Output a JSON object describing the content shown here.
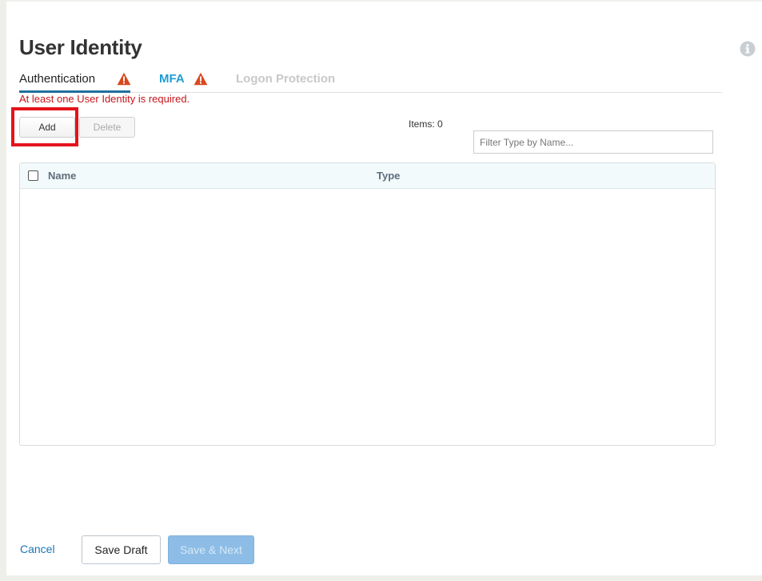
{
  "page": {
    "title": "User Identity"
  },
  "tabs": [
    {
      "label": "Authentication",
      "state": "active",
      "warning": true
    },
    {
      "label": "MFA",
      "state": "enabled",
      "warning": true
    },
    {
      "label": "Logon Protection",
      "state": "disabled",
      "warning": false
    }
  ],
  "error": {
    "message": "At least one User Identity is required."
  },
  "toolbar": {
    "add_label": "Add",
    "delete_label": "Delete",
    "items_label": "Items: 0",
    "filter_placeholder": "Filter Type by Name..."
  },
  "grid": {
    "columns": [
      "Name",
      "Type"
    ],
    "rows": []
  },
  "footer": {
    "cancel_label": "Cancel",
    "save_draft_label": "Save Draft",
    "save_next_label": "Save & Next"
  },
  "colors": {
    "error": "#c4161c",
    "warning": "#d9481e",
    "accent": "#1e9cd7",
    "highlight": "#e4141b"
  },
  "icons": {
    "info": "info-icon",
    "warning": "warning-icon"
  }
}
